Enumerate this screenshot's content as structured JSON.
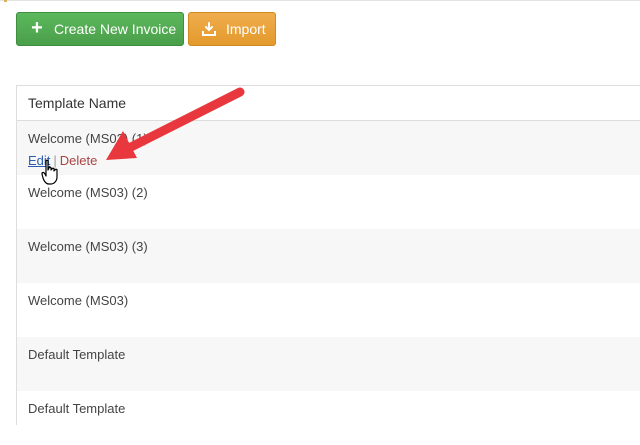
{
  "toolbar": {
    "create_label": "Create New Invoice",
    "import_label": "Import",
    "create_icon": "plus-icon",
    "import_icon": "import-icon",
    "colors": {
      "create": "#5cb85c",
      "import": "#f0ad4e"
    }
  },
  "table": {
    "header": "Template Name",
    "rows": [
      {
        "name": "Welcome (MS03) (1)",
        "edit": "Edit",
        "separator": "|",
        "delete": "Delete"
      },
      {
        "name": "Welcome (MS03) (2)"
      },
      {
        "name": "Welcome (MS03) (3)"
      },
      {
        "name": "Welcome (MS03)"
      },
      {
        "name": "Default Template"
      },
      {
        "name": "Default Template"
      }
    ]
  },
  "annotation": {
    "arrow_color": "#e8383d",
    "cursor": "hand-pointer-cursor"
  }
}
